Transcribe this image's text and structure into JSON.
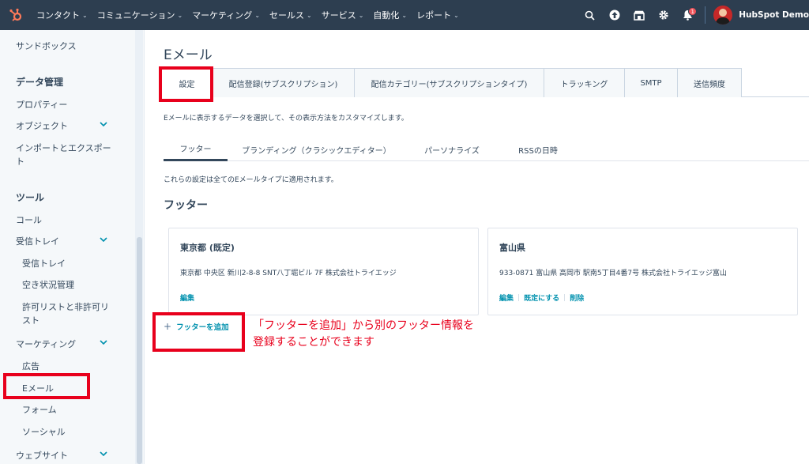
{
  "topnav": {
    "items": [
      {
        "label": "コンタクト"
      },
      {
        "label": "コミュニケーション"
      },
      {
        "label": "マーケティング"
      },
      {
        "label": "セールス"
      },
      {
        "label": "サービス"
      },
      {
        "label": "自動化"
      },
      {
        "label": "レポート"
      }
    ],
    "notification_count": "1",
    "user_name": "HubSpot Demo"
  },
  "sidebar": {
    "sandbox": "サンドボックス",
    "data_heading": "データ管理",
    "properties": "プロパティー",
    "objects": "オブジェクト",
    "import_line1": "インポートとエクスポー",
    "import_line2": "ト",
    "tools_heading": "ツール",
    "calling": "コール",
    "inbox_group": "受信トレイ",
    "inbox": "受信トレイ",
    "availability": "空き状況管理",
    "allow_line1": "許可リストと非許可リ",
    "allow_line2": "スト",
    "marketing_group": "マーケティング",
    "ads": "広告",
    "email": "Eメール",
    "forms": "フォーム",
    "social": "ソーシャル",
    "website": "ウェブサイト"
  },
  "main": {
    "title": "Eメール",
    "tabs": [
      {
        "label": "設定"
      },
      {
        "label": "配信登録(サブスクリプション)"
      },
      {
        "label": "配信カテゴリー(サブスクリプションタイプ)"
      },
      {
        "label": "トラッキング"
      },
      {
        "label": "SMTP"
      },
      {
        "label": "送信頻度"
      }
    ],
    "description": "Eメールに表示するデータを選択して、その表示方法をカスタマイズします。",
    "subtabs": [
      {
        "label": "フッター"
      },
      {
        "label": "ブランディング（クラシックエディター）"
      },
      {
        "label": "パーソナライズ"
      },
      {
        "label": "RSSの日時"
      }
    ],
    "note": "これらの設定は全てのEメールタイプに適用されます。",
    "section_title": "フッター",
    "cards": [
      {
        "title": "東京都 (既定)",
        "address": "東京都 中央区 新川2-8-8 SNT八丁堀ビル 7F 株式会社トライエッジ",
        "actions": [
          "編集"
        ]
      },
      {
        "title": "富山県",
        "address": "933-0871 富山県 高岡市 駅南5丁目4番7号 株式会社トライエッジ富山",
        "actions": [
          "編集",
          "既定にする",
          "削除"
        ]
      }
    ],
    "add_footer": "フッターを追加"
  },
  "annotation": {
    "line1": "「フッターを追加」から別のフッター情報を",
    "line2": "登録することができます",
    "color": "#e8001c"
  },
  "colors": {
    "nav_bg": "#2d3e50",
    "link": "#0091ae",
    "highlight": "#e8001c",
    "logo": "#ff7a59"
  }
}
